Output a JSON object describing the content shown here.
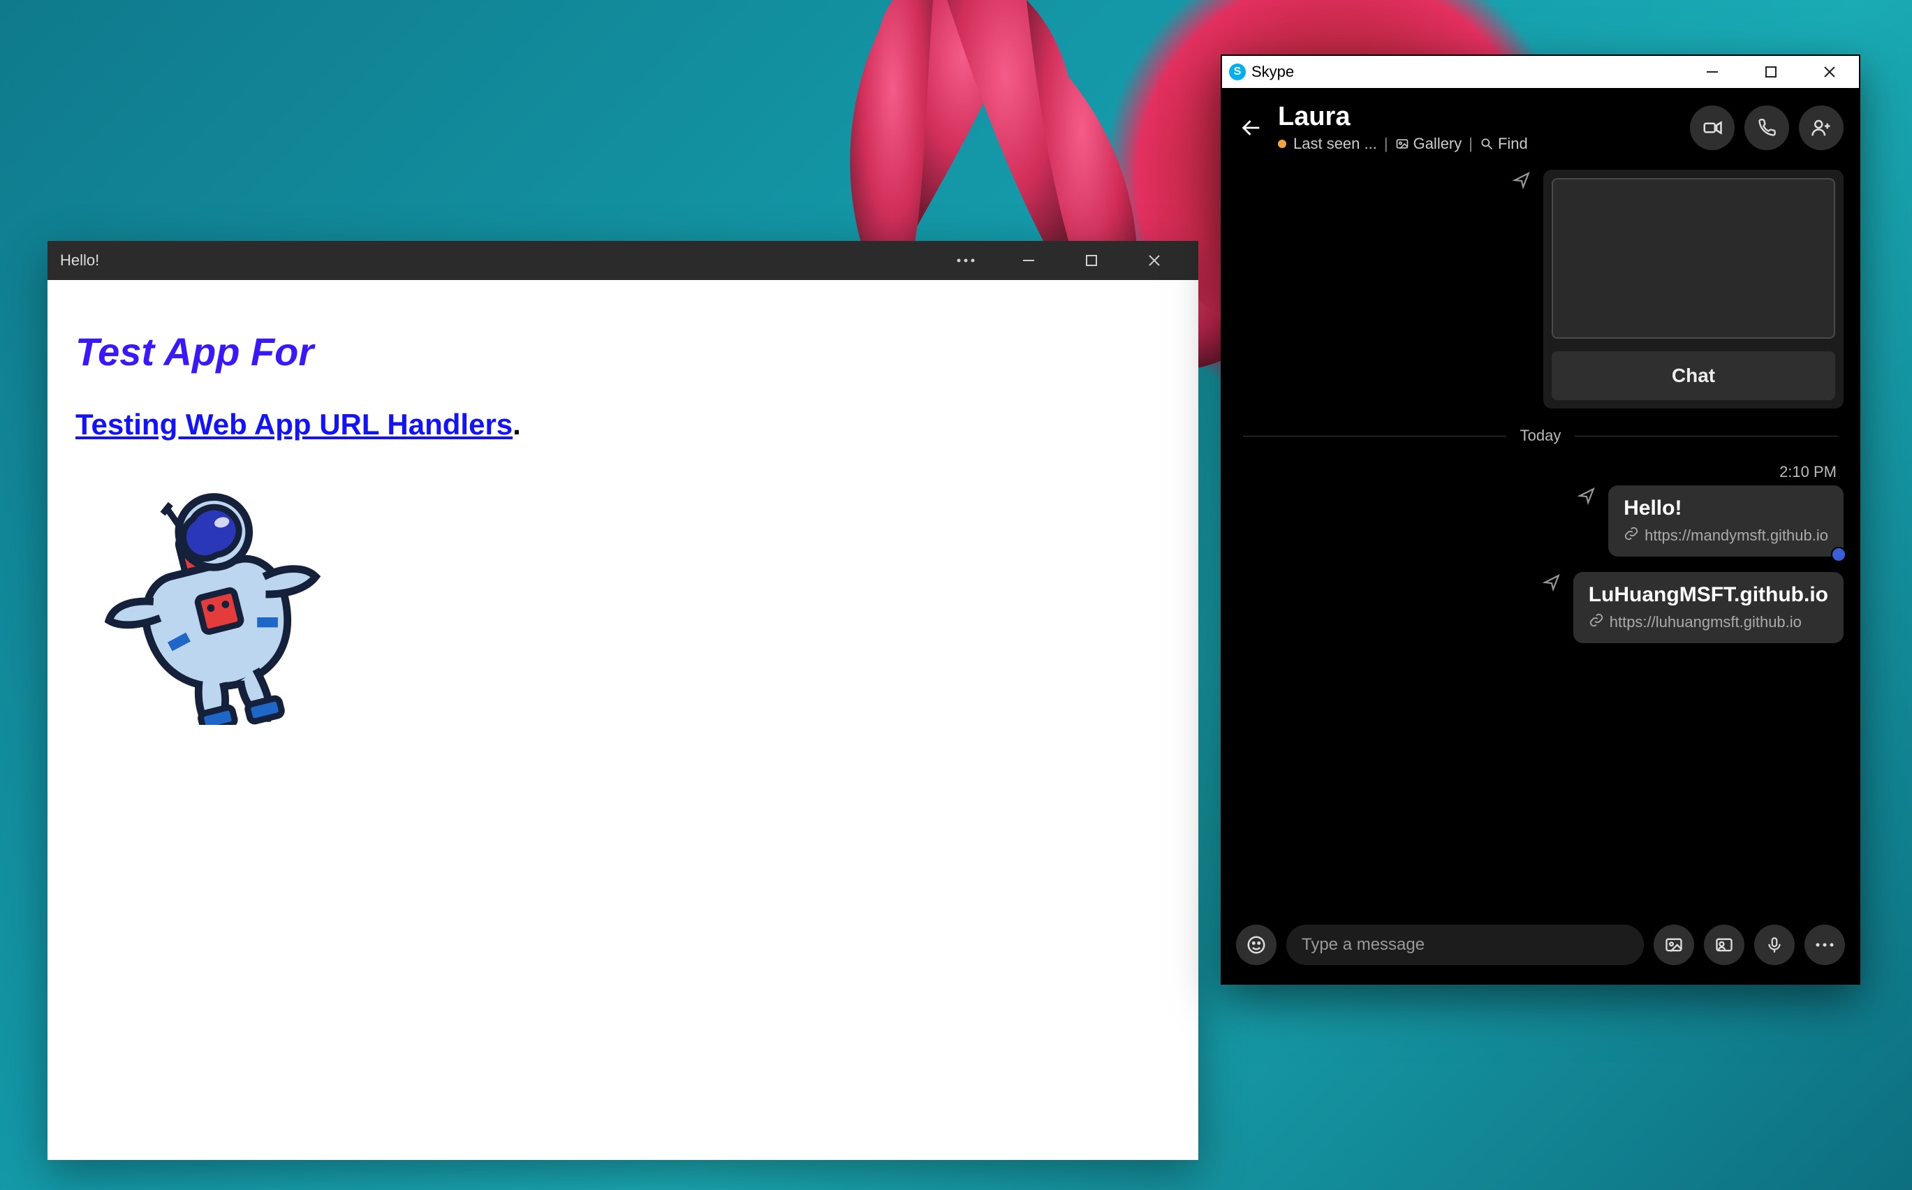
{
  "wallpaper": {
    "accent_flower": "#d92b57",
    "bg_teal": "#149aa9"
  },
  "app_window": {
    "title": "Hello!",
    "heading": "Test App For",
    "link_text": "Testing Web App URL Handlers",
    "trailing": "."
  },
  "skype": {
    "app_name": "Skype",
    "contact_name": "Laura",
    "last_seen": "Last seen ...",
    "gallery_label": "Gallery",
    "find_label": "Find",
    "preview": {
      "chat_button": "Chat"
    },
    "day_label": "Today",
    "time_label": "2:10 PM",
    "messages": [
      {
        "title": "Hello!",
        "url": "https://mandymsft.github.io",
        "has_reaction": true
      },
      {
        "title": "LuHuangMSFT.github.io",
        "url": "https://luhuangmsft.github.io",
        "has_reaction": false
      }
    ],
    "composer": {
      "placeholder": "Type a message"
    }
  }
}
